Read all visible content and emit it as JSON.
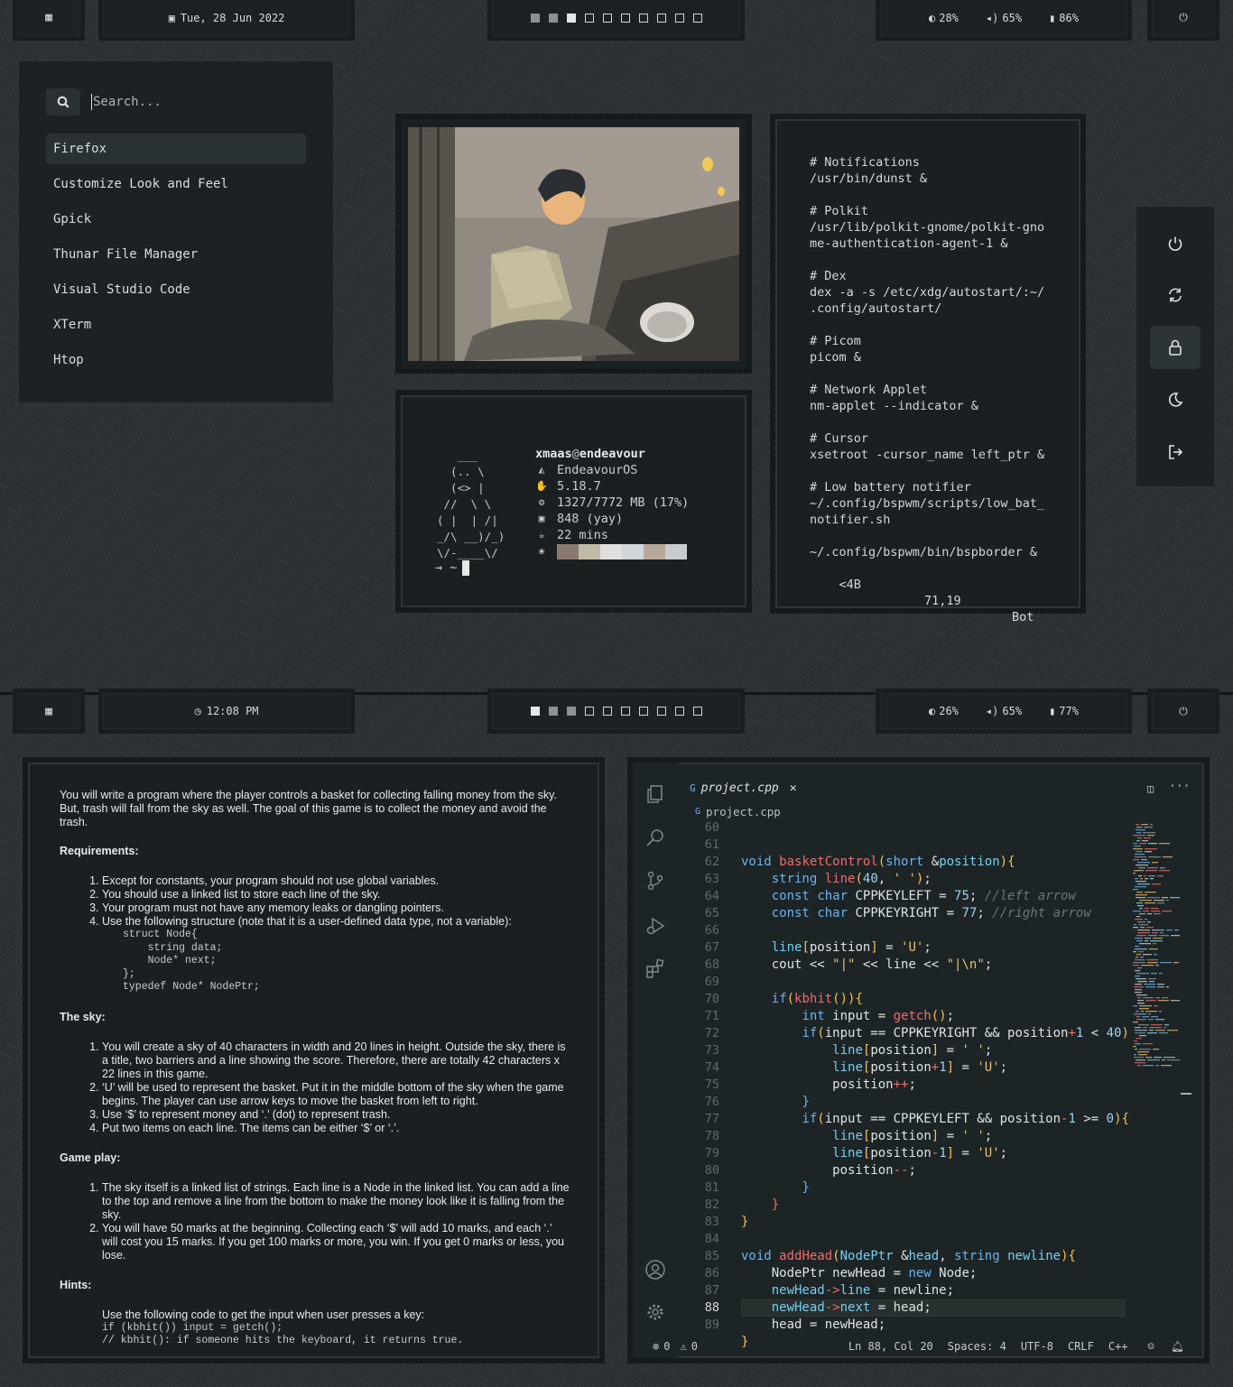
{
  "top_bar": {
    "date": "Tue, 28 Jun 2022",
    "brightness": "28%",
    "volume": "65%",
    "battery": "86%",
    "workspaces": [
      "filled",
      "filled",
      "current",
      "empty",
      "empty",
      "empty",
      "empty",
      "empty",
      "empty",
      "empty"
    ]
  },
  "launcher": {
    "placeholder": "Search...",
    "apps": [
      "Firefox",
      "Customize Look and Feel",
      "Gpick",
      "Thunar File Manager",
      "Visual Studio Code",
      "XTerm",
      "Htop"
    ]
  },
  "fetch": {
    "ascii": "   ___\n  (.. \\\n  (<> |\n //  \\ \\\n( |  | /|\n_/\\ __)/_)\n\\/-____\\/",
    "user": "xmaas",
    "at": "@",
    "host": "endeavour",
    "os": "EndeavourOS",
    "kernel": "5.18.7",
    "memory": "1327/7772 MB (17%)",
    "packages": "848 (yay)",
    "uptime": "22 mins",
    "prompt": "→  ~",
    "palette": [
      "#8a7a72",
      "#c2baa9",
      "#e0dfdb",
      "#d1d6da",
      "#b8a89a",
      "#c8ccce"
    ]
  },
  "config": {
    "lines": [
      "# Notifications",
      "/usr/bin/dunst &",
      "",
      "# Polkit",
      "/usr/lib/polkit-gnome/polkit-gno",
      "me-authentication-agent-1 &",
      "",
      "# Dex",
      "dex -a -s /etc/xdg/autostart/:~/",
      ".config/autostart/",
      "",
      "# Picom",
      "picom &",
      "",
      "# Network Applet",
      "nm-applet --indicator &",
      "",
      "# Cursor",
      "xsetroot -cursor_name left_ptr &",
      "",
      "# Low battery notifier",
      "~/.config/bspwm/scripts/low_bat_",
      "notifier.sh",
      "",
      "~/.config/bspwm/bin/bspborder &"
    ],
    "status_left": "<4B",
    "status_pos": "71,19",
    "status_right": "Bot"
  },
  "bottom_bar": {
    "time": "12:08 PM",
    "brightness": "26%",
    "volume": "65%",
    "battery": "77%",
    "workspaces": [
      "current",
      "filled",
      "filled",
      "empty",
      "empty",
      "empty",
      "empty",
      "empty",
      "empty",
      "empty"
    ]
  },
  "assignment": {
    "intro": "You will write a program where the player controls a basket for collecting falling money from the sky. But, trash will fall from the sky as well. The goal of this game is to collect the money and avoid the trash.",
    "req_title": "Requirements:",
    "requirements": [
      "Except for constants, your program should not use global variables.",
      "You should use a linked list to store each line of the sky.",
      "Your program must not have any memory leaks or dangling pointers.",
      "Use the following structure (note that it is a user-defined data type, not a variable):"
    ],
    "struct_code": "struct Node{\n    string data;\n    Node* next;\n};\ntypedef Node* NodePtr;",
    "sky_title": "The sky:",
    "sky": [
      "You will create a sky of 40 characters in width and 20 lines in height. Outside the sky, there is a title, two barriers and a line showing the score. Therefore, there are totally 42 characters x 22 lines in this game.",
      "‘U’ will be used to represent the basket. Put it in the middle bottom of the sky when the game begins. The player can use arrow keys to move the basket from left to right.",
      "Use ‘$’ to represent money and ‘.’ (dot) to represent trash.",
      "Put two items on each line. The items can be either ‘$’ or ‘.’."
    ],
    "game_title": "Game play:",
    "game": [
      "The sky itself is a linked list of strings. Each line is a Node in the linked list. You can add a line to the top and remove a line from the bottom to make the money look like it is falling from the sky.",
      "You will have 50 marks at the beginning. Collecting each ‘$’ will add 10 marks, and each ‘.’ will cost you 15 marks. If you get 100 marks or more, you win. If you get 0 marks or less, you lose."
    ],
    "hints_title": "Hints:",
    "hint_text": "Use the following code to get the input when user presses a key:",
    "hint_code": "if (kbhit()) input = getch();\n// kbhit(): if someone hits the keyboard, it returns true."
  },
  "vscode": {
    "tab": "project.cpp",
    "breadcrumb": "project.cpp",
    "line_numbers": [
      "60",
      "61",
      "62",
      "63",
      "64",
      "65",
      "66",
      "67",
      "68",
      "69",
      "70",
      "71",
      "72",
      "73",
      "74",
      "75",
      "76",
      "77",
      "78",
      "79",
      "80",
      "81",
      "82",
      "83",
      "84",
      "85",
      "86",
      "87",
      "88",
      "89"
    ],
    "current_line": "88",
    "status": {
      "errors": "0",
      "warnings": "0",
      "position": "Ln 88, Col 20",
      "spaces": "Spaces: 4",
      "encoding": "UTF-8",
      "eol": "CRLF",
      "language": "C++"
    }
  }
}
